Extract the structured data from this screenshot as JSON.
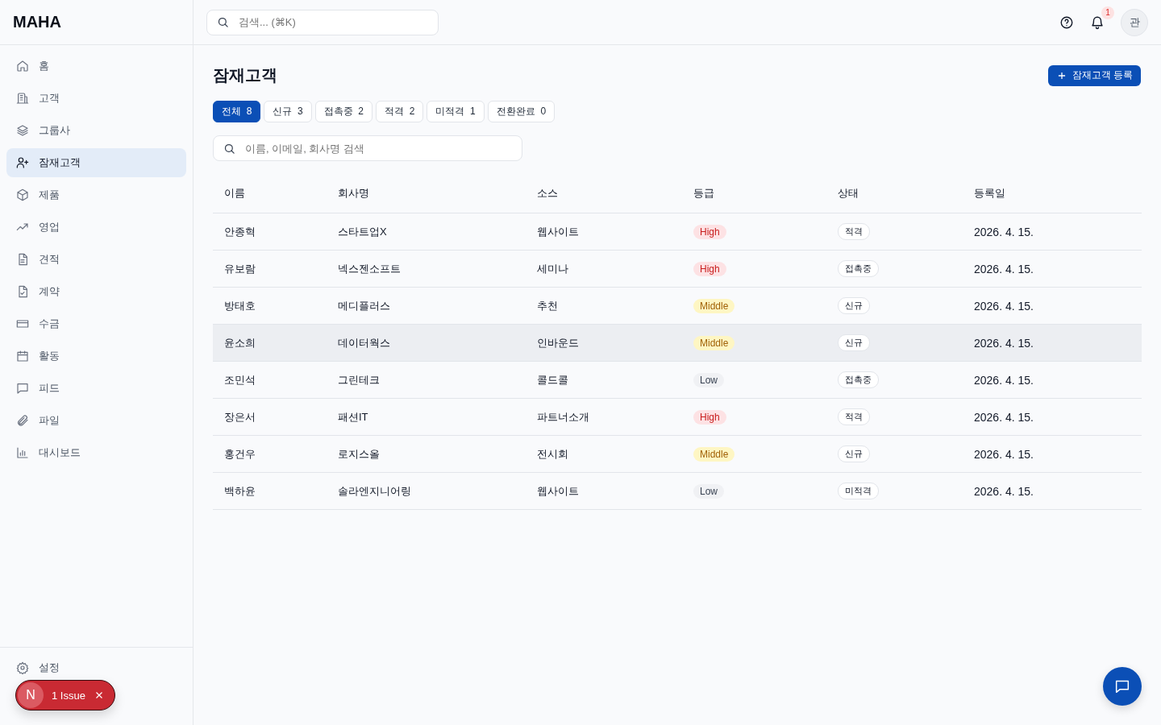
{
  "logo": "MAHA",
  "sidebar": {
    "items": [
      {
        "label": "홈",
        "selected": false
      },
      {
        "label": "고객",
        "selected": false
      },
      {
        "label": "그룹사",
        "selected": false
      },
      {
        "label": "잠재고객",
        "selected": true
      },
      {
        "label": "제품",
        "selected": false
      },
      {
        "label": "영업",
        "selected": false
      },
      {
        "label": "견적",
        "selected": false
      },
      {
        "label": "계약",
        "selected": false
      },
      {
        "label": "수금",
        "selected": false
      },
      {
        "label": "활동",
        "selected": false
      },
      {
        "label": "피드",
        "selected": false
      },
      {
        "label": "파일",
        "selected": false
      },
      {
        "label": "대시보드",
        "selected": false
      }
    ],
    "settings": "설정"
  },
  "topbar": {
    "search_placeholder": "검색... (⌘K)",
    "notification_count": "1",
    "avatar": "관"
  },
  "page": {
    "title": "잠재고객",
    "add_button": "잠재고객 등록"
  },
  "filter_tabs": [
    {
      "label": "전체",
      "count": "8",
      "selected": true
    },
    {
      "label": "신규",
      "count": "3",
      "selected": false
    },
    {
      "label": "접촉중",
      "count": "2",
      "selected": false
    },
    {
      "label": "적격",
      "count": "2",
      "selected": false
    },
    {
      "label": "미적격",
      "count": "1",
      "selected": false
    },
    {
      "label": "전환완료",
      "count": "0",
      "selected": false
    }
  ],
  "search": {
    "placeholder": "이름, 이메일, 회사명 검색"
  },
  "table": {
    "columns": [
      "이름",
      "회사명",
      "소스",
      "등급",
      "상태",
      "등록일"
    ],
    "rows": [
      {
        "name": "안종혁",
        "company": "스타트업X",
        "source": "웹사이트",
        "grade": "High",
        "kind": "high",
        "status": "적격",
        "date": "2026. 4. 15.",
        "highlighted": false
      },
      {
        "name": "유보람",
        "company": "넥스젠소프트",
        "source": "세미나",
        "grade": "High",
        "kind": "high",
        "status": "접촉중",
        "date": "2026. 4. 15.",
        "highlighted": false
      },
      {
        "name": "방태호",
        "company": "메디플러스",
        "source": "추천",
        "grade": "Middle",
        "kind": "middle",
        "status": "신규",
        "date": "2026. 4. 15.",
        "highlighted": false
      },
      {
        "name": "윤소희",
        "company": "데이터웍스",
        "source": "인바운드",
        "grade": "Middle",
        "kind": "middle",
        "status": "신규",
        "date": "2026. 4. 15.",
        "highlighted": true
      },
      {
        "name": "조민석",
        "company": "그린테크",
        "source": "콜드콜",
        "grade": "Low",
        "kind": "low",
        "status": "접촉중",
        "date": "2026. 4. 15.",
        "highlighted": false
      },
      {
        "name": "장은서",
        "company": "패션IT",
        "source": "파트너소개",
        "grade": "High",
        "kind": "high",
        "status": "적격",
        "date": "2026. 4. 15.",
        "highlighted": false
      },
      {
        "name": "홍건우",
        "company": "로지스올",
        "source": "전시회",
        "grade": "Middle",
        "kind": "middle",
        "status": "신규",
        "date": "2026. 4. 15.",
        "highlighted": false
      },
      {
        "name": "백하윤",
        "company": "솔라엔지니어링",
        "source": "웹사이트",
        "grade": "Low",
        "kind": "low",
        "status": "미적격",
        "date": "2026. 4. 15.",
        "highlighted": false
      }
    ]
  },
  "issue_badge": {
    "letter": "N",
    "label": "1 Issue"
  }
}
